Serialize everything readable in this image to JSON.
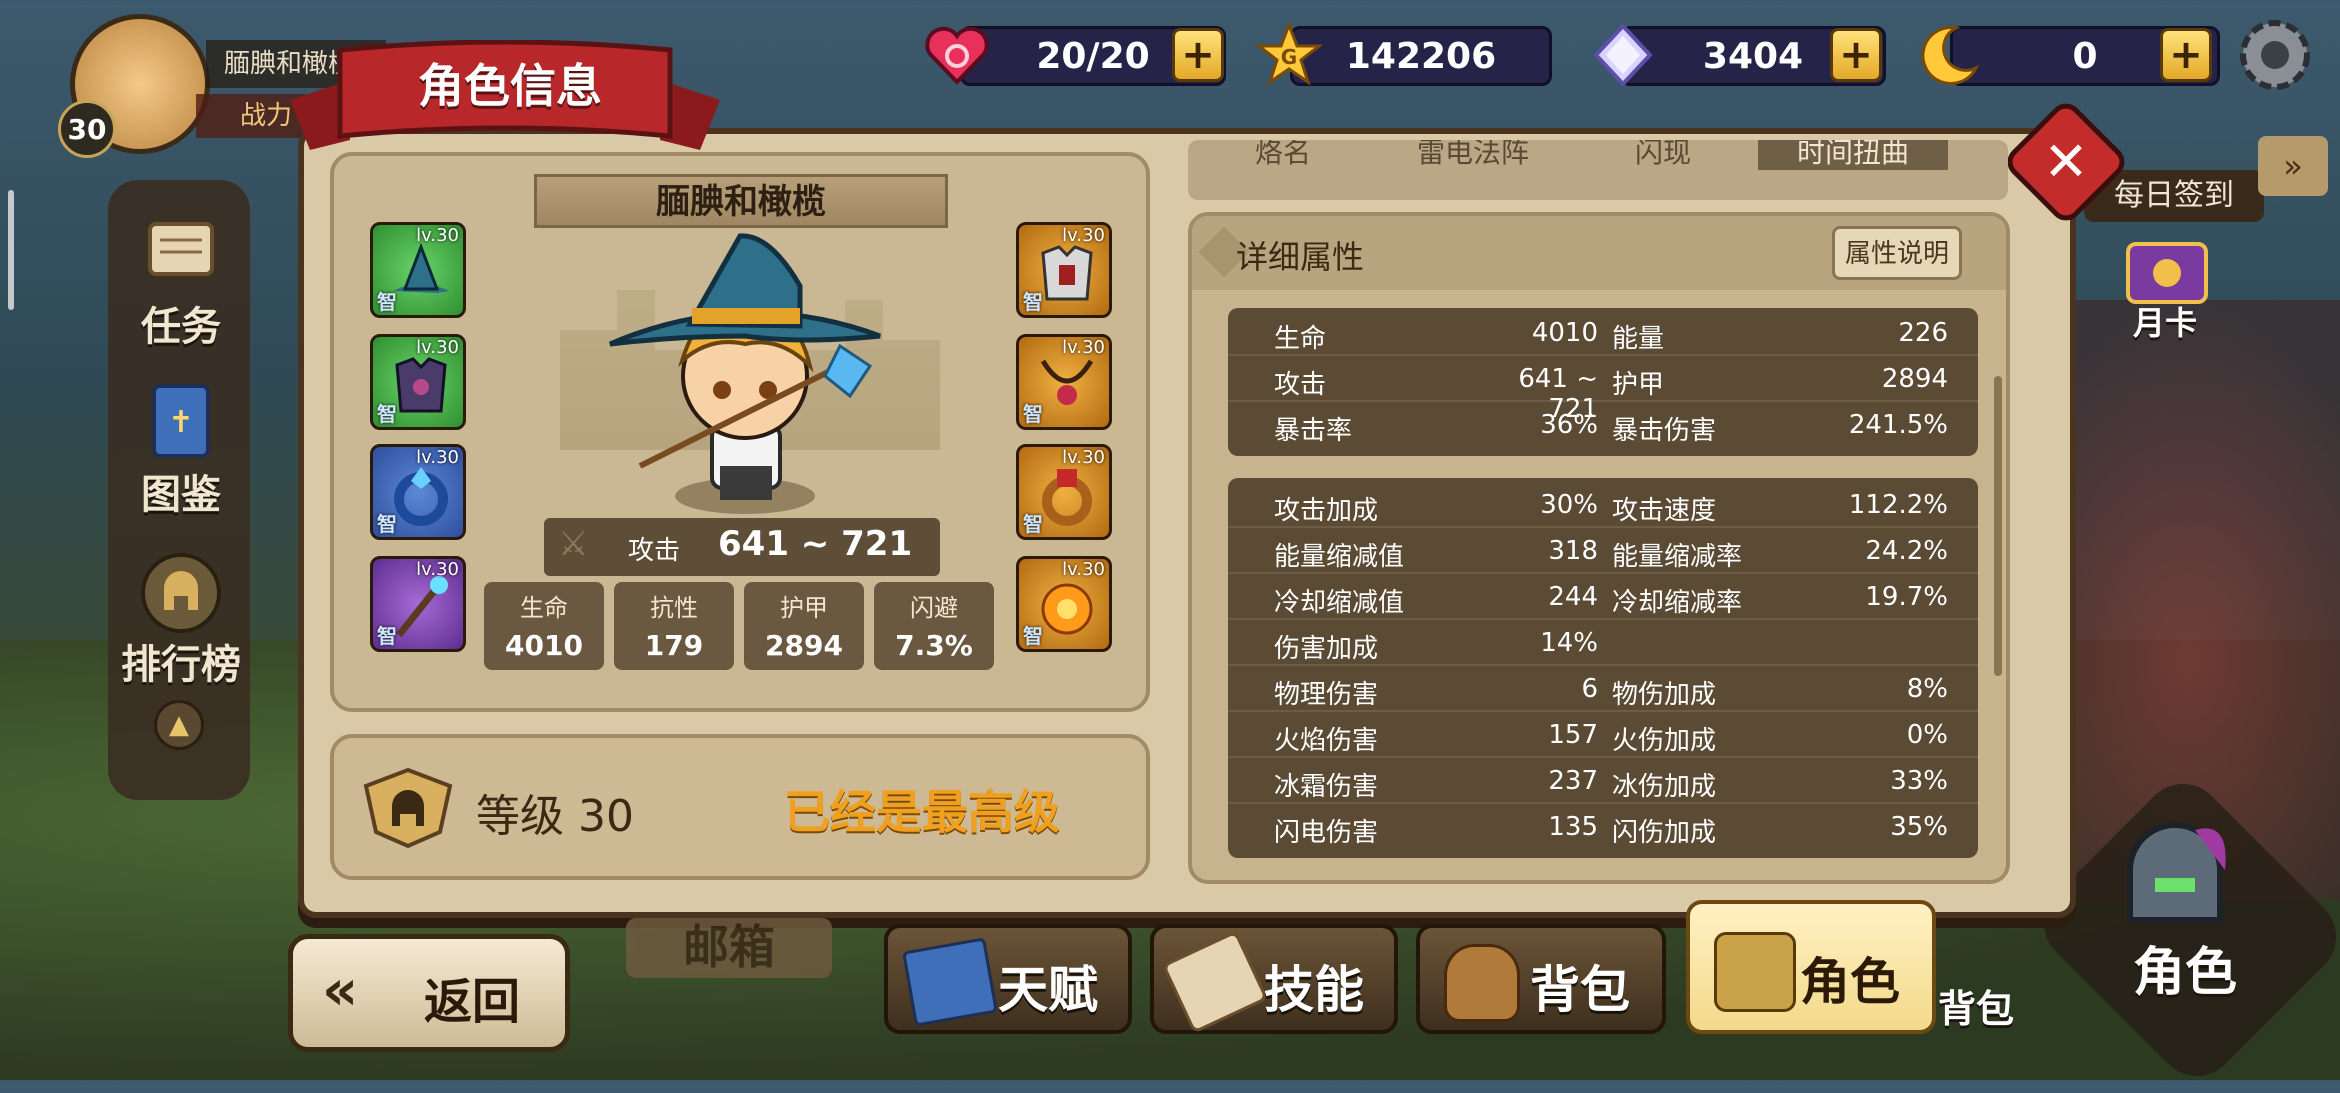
{
  "player": {
    "name": "腼腆和橄榄",
    "level_badge": "30",
    "title_label": "战力"
  },
  "topbar": {
    "hearts": "20/20",
    "gold": "142206",
    "gems": "3404",
    "moons": "0"
  },
  "side_nav": {
    "quests": "任务",
    "codex": "图鉴",
    "ranking": "排行榜"
  },
  "right_side": {
    "daily_signin": "每日签到",
    "month_card": "月卡",
    "role_big": "角色",
    "bag_small": "背包"
  },
  "panel": {
    "title": "角色信息",
    "char_name": "腼腆和橄榄",
    "attack_label": "攻击",
    "attack_value": "641 ~ 721",
    "equip_level": "lv.30",
    "equip_tag": "智",
    "stats": [
      {
        "label": "生命",
        "value": "4010"
      },
      {
        "label": "抗性",
        "value": "179"
      },
      {
        "label": "护甲",
        "value": "2894"
      },
      {
        "label": "闪避",
        "value": "7.3%"
      }
    ],
    "level_label": "等级 30",
    "max_level_text": "已经是最高级"
  },
  "detail": {
    "title": "详细属性",
    "explain_button": "属性说明",
    "top_tabs": [
      "烙名",
      "雷电法阵",
      "闪现",
      "时间扭曲"
    ],
    "group1": [
      {
        "k1": "生命",
        "v1": "4010",
        "k2": "能量",
        "v2": "226"
      },
      {
        "k1": "攻击",
        "v1": "641 ~ 721",
        "k2": "护甲",
        "v2": "2894"
      },
      {
        "k1": "暴击率",
        "v1": "36%",
        "k2": "暴击伤害",
        "v2": "241.5%"
      }
    ],
    "group2": [
      {
        "k1": "攻击加成",
        "v1": "30%",
        "k2": "攻击速度",
        "v2": "112.2%"
      },
      {
        "k1": "能量缩减值",
        "v1": "318",
        "k2": "能量缩减率",
        "v2": "24.2%"
      },
      {
        "k1": "冷却缩减值",
        "v1": "244",
        "k2": "冷却缩减率",
        "v2": "19.7%"
      },
      {
        "k1": "伤害加成",
        "v1": "14%",
        "k2": "",
        "v2": ""
      },
      {
        "k1": "物理伤害",
        "v1": "6",
        "k2": "物伤加成",
        "v2": "8%"
      },
      {
        "k1": "火焰伤害",
        "v1": "157",
        "k2": "火伤加成",
        "v2": "0%"
      },
      {
        "k1": "冰霜伤害",
        "v1": "237",
        "k2": "冰伤加成",
        "v2": "33%"
      },
      {
        "k1": "闪电伤害",
        "v1": "135",
        "k2": "闪伤加成",
        "v2": "35%"
      }
    ]
  },
  "bottom_nav": {
    "back": "返回",
    "mailbox": "邮箱",
    "talent": "天赋",
    "skills": "技能",
    "bag": "背包",
    "role": "角色"
  },
  "colors": {
    "panel_bg": "#d9c9a6",
    "ribbon_red": "#b8282a",
    "max_level_orange": "#f0a020",
    "stat_bg": "#5b4b35"
  }
}
